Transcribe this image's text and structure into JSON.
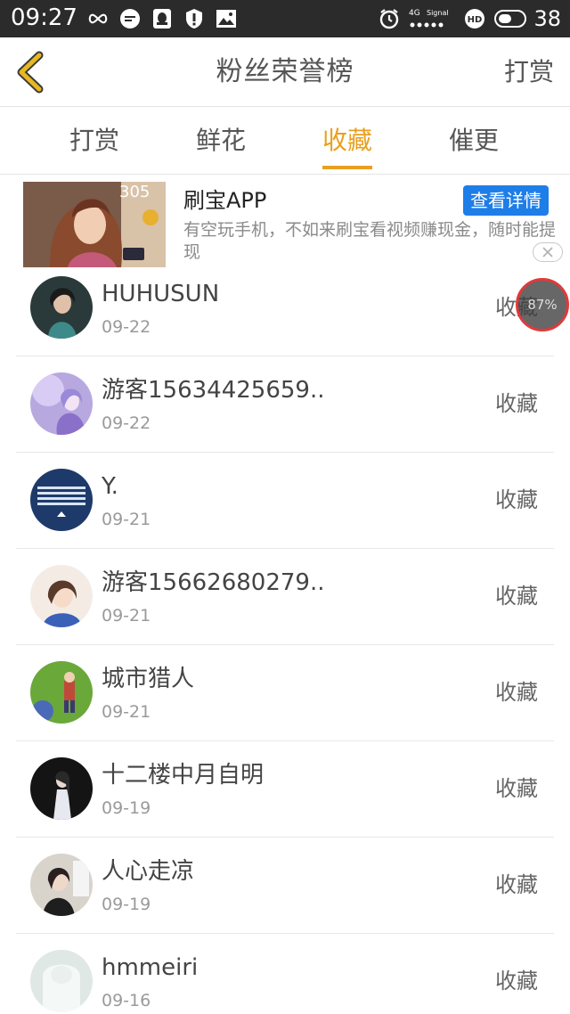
{
  "status_bar": {
    "time": "09:27",
    "network": "4G",
    "signal_label": "Signal",
    "hd_badge": "HD",
    "battery": "38"
  },
  "nav": {
    "title": "粉丝荣誉榜",
    "action": "打赏"
  },
  "tabs": [
    {
      "label": "打赏",
      "active": false
    },
    {
      "label": "鲜花",
      "active": false
    },
    {
      "label": "收藏",
      "active": true
    },
    {
      "label": "催更",
      "active": false
    }
  ],
  "ad": {
    "title": "刷宝APP",
    "cta": "查看详情",
    "description": "有空玩手机，不如来刷宝看视频赚现金，随时能提现",
    "image_text": "305"
  },
  "list": [
    {
      "name": "HUHUSUN",
      "date": "09-22",
      "action": "收藏"
    },
    {
      "name": "游客15634425659..",
      "date": "09-22",
      "action": "收藏"
    },
    {
      "name": "Y.",
      "date": "09-21",
      "action": "收藏"
    },
    {
      "name": "游客15662680279..",
      "date": "09-21",
      "action": "收藏"
    },
    {
      "name": "城市猎人",
      "date": "09-21",
      "action": "收藏"
    },
    {
      "name": "十二楼中月自明",
      "date": "09-19",
      "action": "收藏"
    },
    {
      "name": "人心走凉",
      "date": "09-19",
      "action": "收藏"
    },
    {
      "name": "hmmeiri",
      "date": "09-16",
      "action": "收藏"
    }
  ],
  "floating_progress": "87%",
  "colors": {
    "accent": "#e8a020",
    "status_bar": "#2b2b2b",
    "cta_blue": "#1e7ee8",
    "progress_ring": "#e03a3a"
  }
}
